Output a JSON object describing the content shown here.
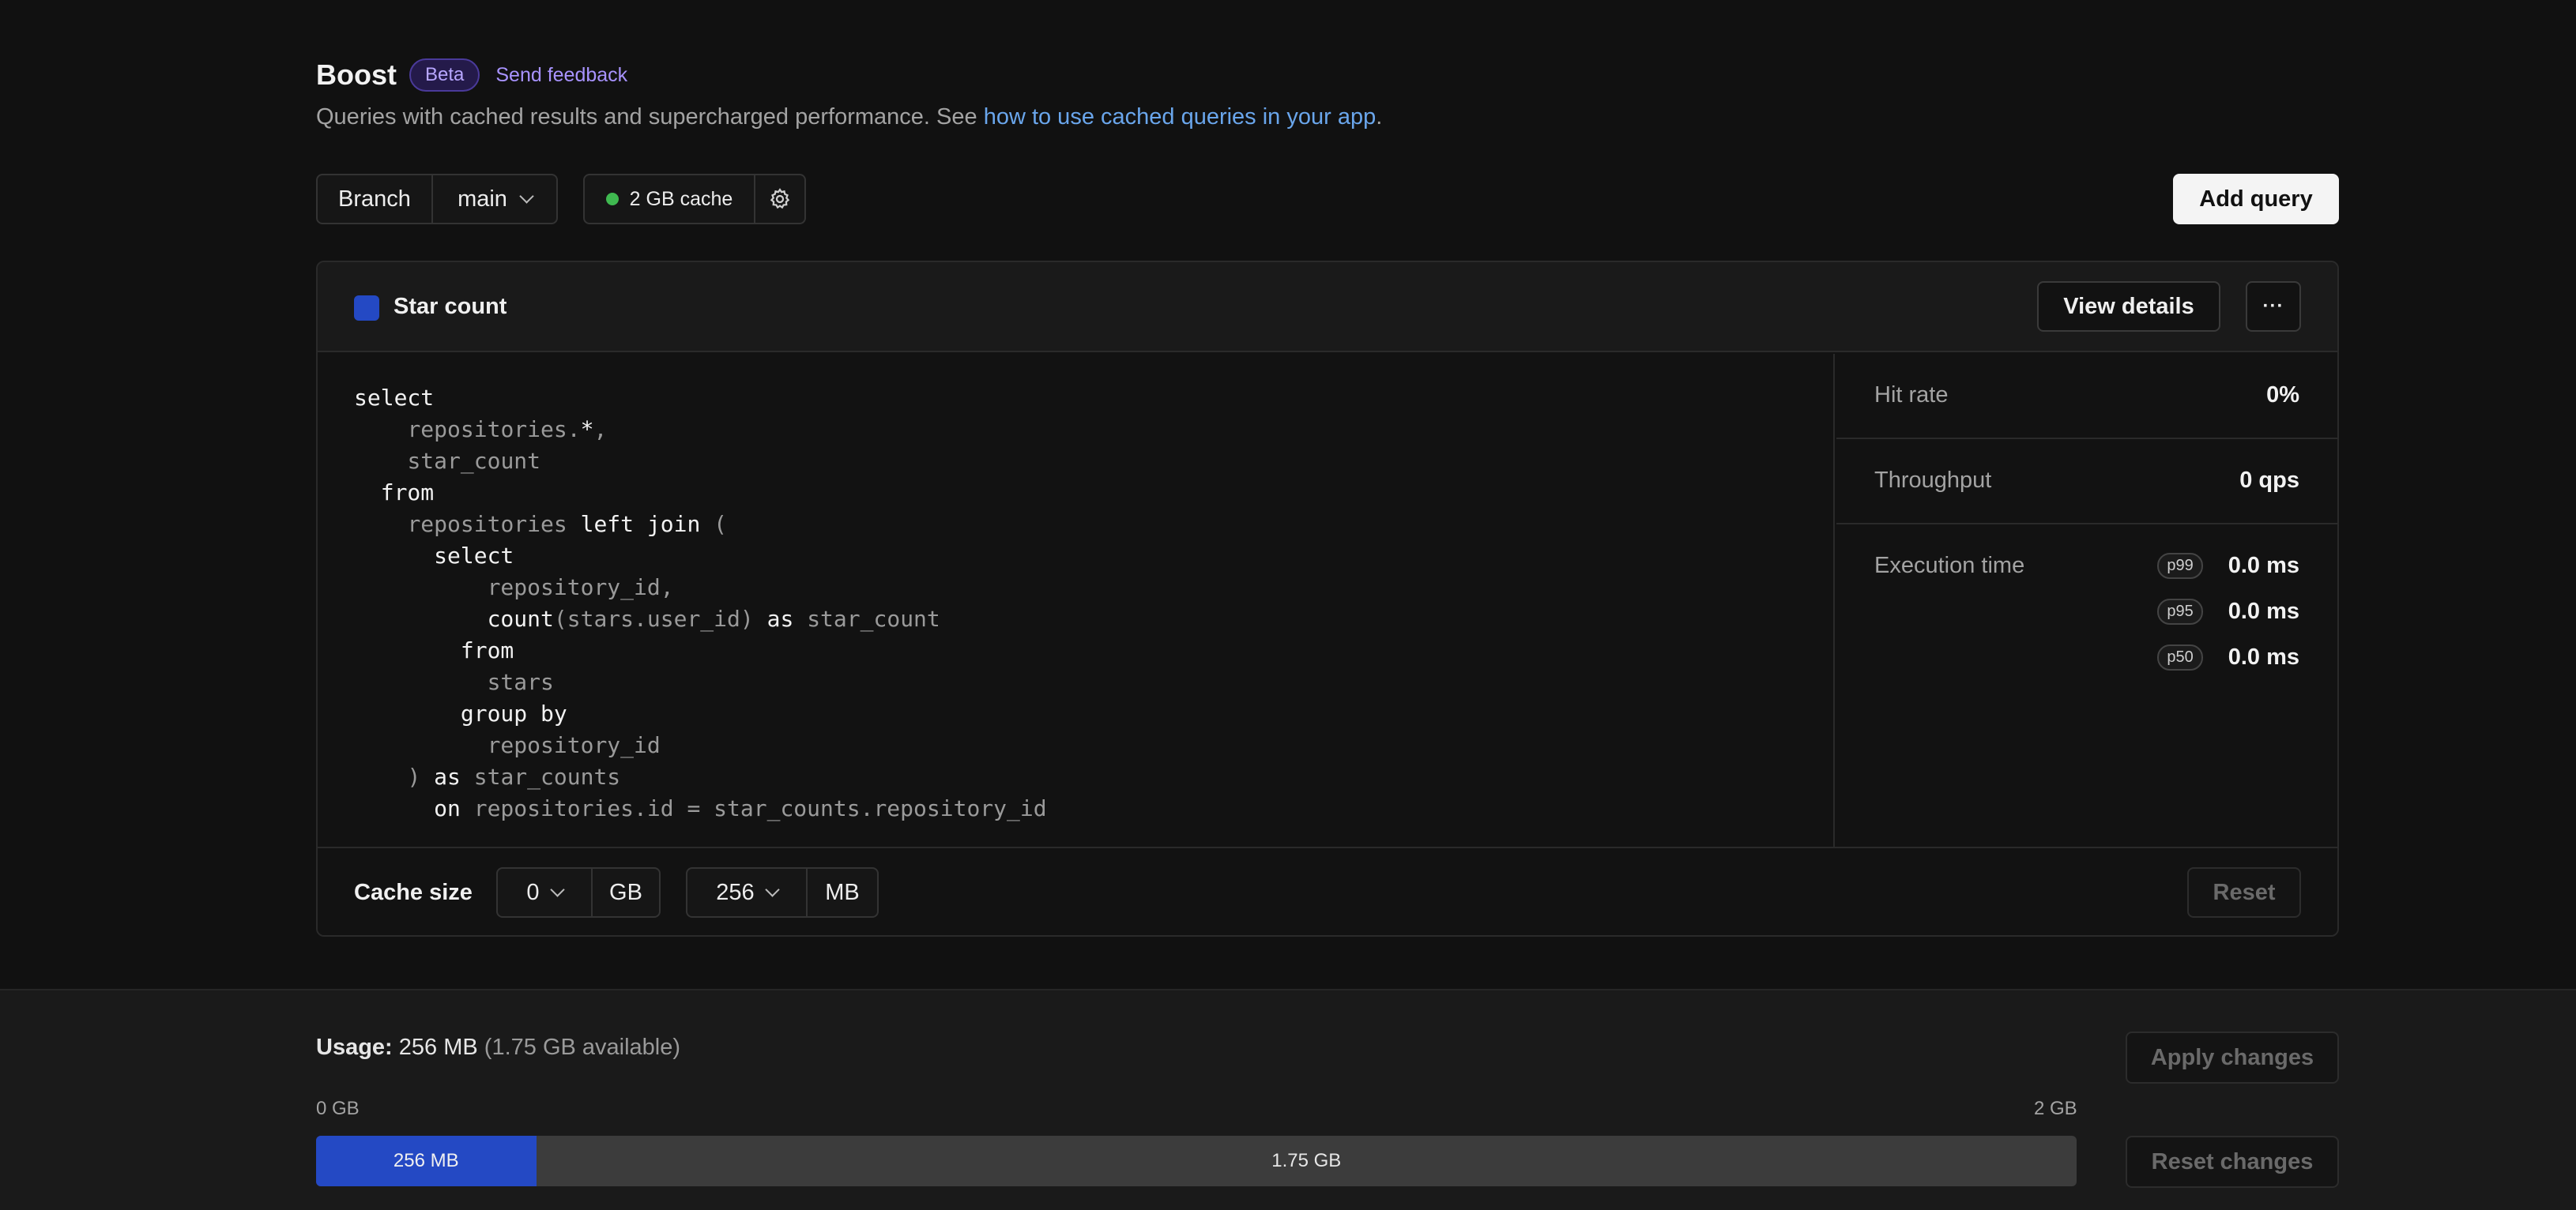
{
  "header": {
    "title": "Boost",
    "badge": "Beta",
    "feedback_link": "Send feedback",
    "subtitle_prefix": "Queries with cached results and supercharged performance. See ",
    "subtitle_link": "how to use cached queries in your app",
    "subtitle_suffix": "."
  },
  "toolbar": {
    "branch_label": "Branch",
    "branch_value": "main",
    "cache_label": "2 GB cache",
    "add_query": "Add query"
  },
  "query": {
    "name": "Star count",
    "color": "#2449c4",
    "view_details": "View details",
    "more": "···",
    "code": [
      [
        {
          "t": "select",
          "c": "kw"
        }
      ],
      [
        {
          "t": "    ",
          "c": "kw"
        },
        {
          "t": "repositories.",
          "c": "id"
        },
        {
          "t": "*",
          "c": "kw"
        },
        {
          "t": ",",
          "c": "id"
        }
      ],
      [
        {
          "t": "    ",
          "c": "kw"
        },
        {
          "t": "star_count",
          "c": "id"
        }
      ],
      [
        {
          "t": "  from",
          "c": "kw"
        }
      ],
      [
        {
          "t": "    ",
          "c": "kw"
        },
        {
          "t": "repositories",
          "c": "id"
        },
        {
          "t": " left join ",
          "c": "kw"
        },
        {
          "t": "(",
          "c": "id"
        }
      ],
      [
        {
          "t": "      select",
          "c": "kw"
        }
      ],
      [
        {
          "t": "          ",
          "c": "kw"
        },
        {
          "t": "repository_id,",
          "c": "id"
        }
      ],
      [
        {
          "t": "          count",
          "c": "kw"
        },
        {
          "t": "(stars.user_id)",
          "c": "id"
        },
        {
          "t": " as ",
          "c": "kw"
        },
        {
          "t": "star_count",
          "c": "id"
        }
      ],
      [
        {
          "t": "        from",
          "c": "kw"
        }
      ],
      [
        {
          "t": "          ",
          "c": "kw"
        },
        {
          "t": "stars",
          "c": "id"
        }
      ],
      [
        {
          "t": "        group by",
          "c": "kw"
        }
      ],
      [
        {
          "t": "          ",
          "c": "kw"
        },
        {
          "t": "repository_id",
          "c": "id"
        }
      ],
      [
        {
          "t": "    ",
          "c": "kw"
        },
        {
          "t": ")",
          "c": "id"
        },
        {
          "t": " as ",
          "c": "kw"
        },
        {
          "t": "star_counts",
          "c": "id"
        }
      ],
      [
        {
          "t": "      on ",
          "c": "kw"
        },
        {
          "t": "repositories.id = star_counts.repository_id",
          "c": "id"
        }
      ]
    ],
    "stats": {
      "hit_rate_label": "Hit rate",
      "hit_rate_value": "0%",
      "throughput_label": "Throughput",
      "throughput_value": "0 qps",
      "execution_label": "Execution time",
      "p99_label": "p99",
      "p99_value": "0.0 ms",
      "p95_label": "p95",
      "p95_value": "0.0 ms",
      "p50_label": "p50",
      "p50_value": "0.0 ms"
    },
    "cache": {
      "label": "Cache size",
      "gb_value": "0",
      "gb_unit": "GB",
      "mb_value": "256",
      "mb_unit": "MB",
      "reset": "Reset"
    }
  },
  "usage": {
    "label": "Usage:",
    "value": "256 MB",
    "available": "(1.75 GB available)",
    "axis_min": "0 GB",
    "axis_max": "2 GB",
    "used_label": "256 MB",
    "available_label": "1.75 GB",
    "used_fraction": 0.125,
    "used_color": "#2449c4",
    "apply": "Apply changes",
    "reset": "Reset changes"
  }
}
